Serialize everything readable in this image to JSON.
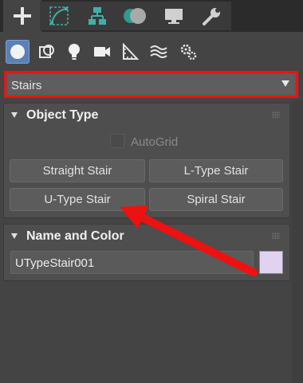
{
  "tabs": [
    {
      "name": "create-tab",
      "icon": "plus-icon",
      "active": true
    },
    {
      "name": "modify-tab",
      "icon": "curve-edit-icon",
      "active": false
    },
    {
      "name": "hierarchy-tab",
      "icon": "hierarchy-icon",
      "active": false
    },
    {
      "name": "motion-tab",
      "icon": "motion-circles-icon",
      "active": false
    },
    {
      "name": "display-tab",
      "icon": "monitor-icon",
      "active": false
    },
    {
      "name": "utilities-tab",
      "icon": "wrench-icon",
      "active": false
    }
  ],
  "subcategories": [
    {
      "name": "geometry",
      "icon": "sphere-icon",
      "active": true
    },
    {
      "name": "shapes",
      "icon": "shapes-icon",
      "active": false
    },
    {
      "name": "lights",
      "icon": "lightbulb-icon",
      "active": false
    },
    {
      "name": "cameras",
      "icon": "camera-icon",
      "active": false
    },
    {
      "name": "helpers",
      "icon": "helper-ruler-icon",
      "active": false
    },
    {
      "name": "space-warps",
      "icon": "waves-icon",
      "active": false
    },
    {
      "name": "systems",
      "icon": "gears-icon",
      "active": false
    }
  ],
  "category_dropdown": {
    "selected": "Stairs",
    "highlight_color": "#ee1111"
  },
  "object_type": {
    "title": "Object Type",
    "autogrid_label": "AutoGrid",
    "autogrid_checked": false,
    "buttons": {
      "straight": "Straight Stair",
      "l_type": "L-Type Stair",
      "u_type": "U-Type Stair",
      "spiral": "Spiral Stair"
    }
  },
  "name_and_color": {
    "title": "Name and Color",
    "name_value": "UTypeStair001",
    "color": "#e2d2f2"
  },
  "annotation": {
    "arrow_color": "#ee1111",
    "points_to": "U-Type Stair"
  },
  "colors": {
    "accent": "#5b80b8",
    "panel": "#4e4e4e",
    "background": "#444444"
  }
}
